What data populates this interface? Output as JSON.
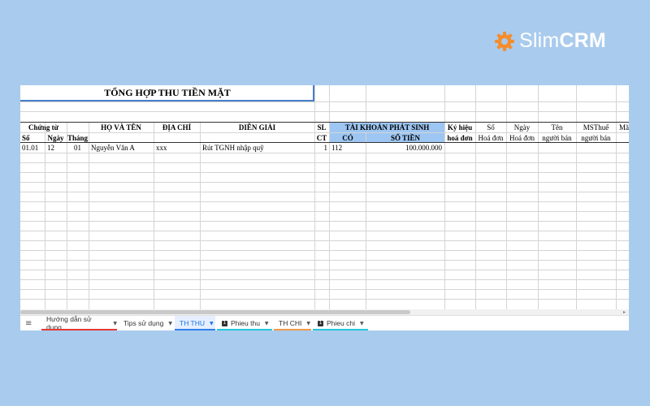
{
  "brand": {
    "name_light": "Slim",
    "name_bold": "CRM"
  },
  "sheet": {
    "title": "TỔNG HỢP THU TIỀN MẶT",
    "headers": {
      "chung_tu": "Chứng từ",
      "so": "Số",
      "ngay": "Ngày",
      "thang": "Tháng",
      "ho_va_ten": "HỌ VÀ TÊN",
      "dia_chi": "ĐỊA CHỈ",
      "dien_giai": "DIỄN GIẢI",
      "sl": "SL",
      "ct": "CT",
      "tai_khoan": "TÀI KHOẢN PHÁT SINH",
      "co": "CÓ",
      "so_tien": "SỐ TIỀN",
      "ky_hieu": "Ký hiệu",
      "hoa_don": "hoá đơn",
      "so2": "Số",
      "hoa_don2": "Hoá đơn",
      "ngay2": "Ngày",
      "hoa_don3": "Hoá đơn",
      "ten": "Tên",
      "nguoi_ban": "người bán",
      "ms_thue": "MSThuế",
      "nguoi_ban2": "người bán",
      "ma": "Mã"
    },
    "rows": [
      {
        "so": "01.01",
        "ngay": "12",
        "thang": "01",
        "ho_ten": "Nguyễn Văn A",
        "dia_chi": "xxx",
        "dien_giai": "Rút TGNH nhập quỹ",
        "sl": "1",
        "co": "112",
        "so_tien": "100.000.000"
      }
    ]
  },
  "tabs": [
    {
      "label": "Hướng dẫn sử dụng",
      "color": "#e53935",
      "icon": false
    },
    {
      "label": "Tips sử dụng",
      "color": "",
      "icon": false
    },
    {
      "label": "TH THU",
      "color": "#2f80ed",
      "icon": false,
      "active": true
    },
    {
      "label": "Phieu thu",
      "color": "#26c6da",
      "icon": true
    },
    {
      "label": "TH CHI",
      "color": "#f2994a",
      "icon": false
    },
    {
      "label": "Phieu chi",
      "color": "#26c6da",
      "icon": true
    }
  ]
}
